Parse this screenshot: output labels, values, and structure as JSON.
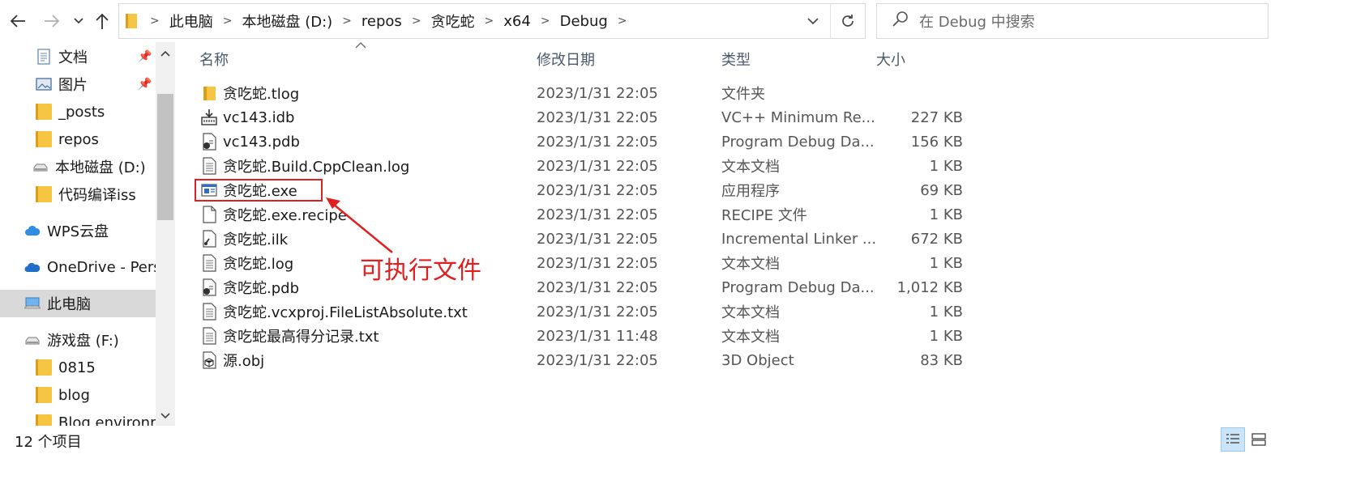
{
  "nav": {
    "back_icon": "back-arrow-icon",
    "forward_icon": "forward-arrow-icon",
    "recent_icon": "chevron-down-icon",
    "up_icon": "up-arrow-icon"
  },
  "address": {
    "crumbs": [
      "此电脑",
      "本地磁盘 (D:)",
      "repos",
      "贪吃蛇",
      "x64",
      "Debug"
    ]
  },
  "search": {
    "placeholder": "在 Debug 中搜索"
  },
  "sidebar": {
    "items": [
      {
        "label": "文档",
        "icon": "documents-icon",
        "pinned": true
      },
      {
        "label": "图片",
        "icon": "pictures-icon",
        "pinned": true
      },
      {
        "label": "_posts",
        "icon": "folder-icon"
      },
      {
        "label": "repos",
        "icon": "folder-icon"
      },
      {
        "label": "本地磁盘 (D:)",
        "icon": "drive-icon"
      },
      {
        "label": "代码编译iss",
        "icon": "folder-icon"
      },
      {
        "label": "WPS云盘",
        "icon": "cloud-icon"
      },
      {
        "label": "OneDrive - Perso",
        "icon": "onedrive-icon"
      },
      {
        "label": "此电脑",
        "icon": "computer-icon",
        "selected": true
      },
      {
        "label": "游戏盘 (F:)",
        "icon": "drive-icon"
      },
      {
        "label": "0815",
        "icon": "folder-icon"
      },
      {
        "label": "blog",
        "icon": "folder-icon"
      },
      {
        "label": "Blog environme",
        "icon": "folder-icon"
      }
    ]
  },
  "columns": {
    "name": "名称",
    "date": "修改日期",
    "type": "类型",
    "size": "大小"
  },
  "files": [
    {
      "name": "贪吃蛇.tlog",
      "date": "2023/1/31 22:05",
      "type": "文件夹",
      "size": "",
      "icon": "folder-icon"
    },
    {
      "name": "vc143.idb",
      "date": "2023/1/31 22:05",
      "type": "VC++ Minimum Re...",
      "size": "227 KB",
      "icon": "idb-file-icon"
    },
    {
      "name": "vc143.pdb",
      "date": "2023/1/31 22:05",
      "type": "Program Debug Da...",
      "size": "156 KB",
      "icon": "pdb-file-icon"
    },
    {
      "name": "贪吃蛇.Build.CppClean.log",
      "date": "2023/1/31 22:05",
      "type": "文本文档",
      "size": "1 KB",
      "icon": "text-file-icon"
    },
    {
      "name": "贪吃蛇.exe",
      "date": "2023/1/31 22:05",
      "type": "应用程序",
      "size": "69 KB",
      "icon": "exe-file-icon"
    },
    {
      "name": "贪吃蛇.exe.recipe",
      "date": "2023/1/31 22:05",
      "type": "RECIPE 文件",
      "size": "1 KB",
      "icon": "blank-file-icon"
    },
    {
      "name": "贪吃蛇.ilk",
      "date": "2023/1/31 22:05",
      "type": "Incremental Linker ...",
      "size": "672 KB",
      "icon": "ilk-file-icon"
    },
    {
      "name": "贪吃蛇.log",
      "date": "2023/1/31 22:05",
      "type": "文本文档",
      "size": "1 KB",
      "icon": "text-file-icon"
    },
    {
      "name": "贪吃蛇.pdb",
      "date": "2023/1/31 22:05",
      "type": "Program Debug Da...",
      "size": "1,012 KB",
      "icon": "pdb-file-icon"
    },
    {
      "name": "贪吃蛇.vcxproj.FileListAbsolute.txt",
      "date": "2023/1/31 22:05",
      "type": "文本文档",
      "size": "1 KB",
      "icon": "text-file-icon"
    },
    {
      "name": "贪吃蛇最高得分记录.txt",
      "date": "2023/1/31 11:48",
      "type": "文本文档",
      "size": "1 KB",
      "icon": "text-file-icon"
    },
    {
      "name": "源.obj",
      "date": "2023/1/31 22:05",
      "type": "3D Object",
      "size": "83 KB",
      "icon": "obj-file-icon"
    }
  ],
  "annotation": {
    "label": "可执行文件",
    "color": "#e02020"
  },
  "status": {
    "count": "12 个项目"
  },
  "colors": {
    "selected_bg": "#d9d9d9",
    "header_text": "#4a5a6e",
    "highlight": "#e02020"
  }
}
